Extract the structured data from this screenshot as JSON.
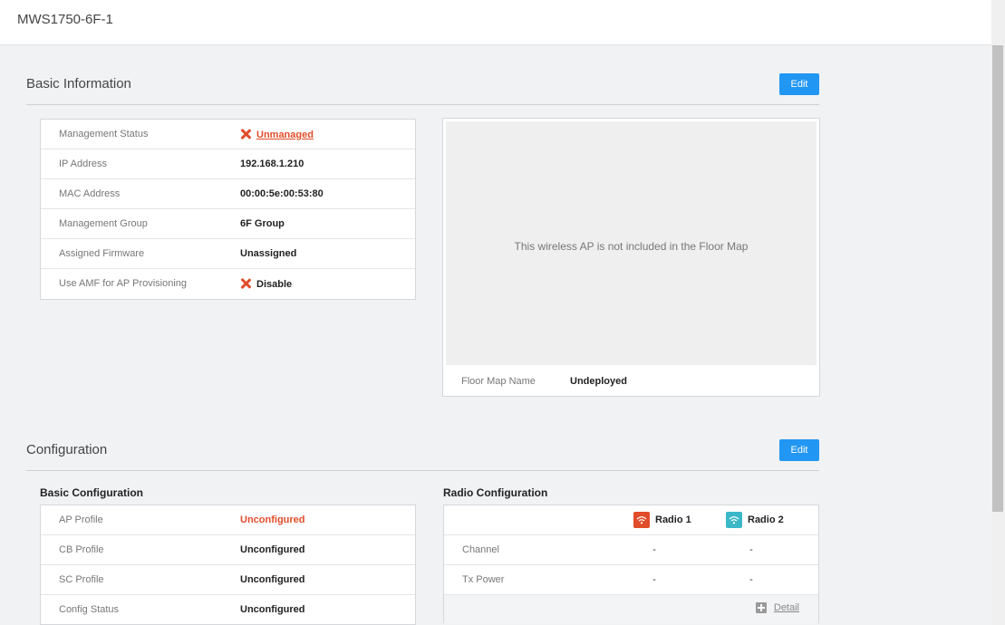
{
  "header": {
    "title": "MWS1750-6F-1"
  },
  "basic_info": {
    "title": "Basic Information",
    "edit_label": "Edit",
    "rows": [
      {
        "label": "Management Status",
        "value": "Unmanaged"
      },
      {
        "label": "IP Address",
        "value": "192.168.1.210"
      },
      {
        "label": "MAC Address",
        "value": "00:00:5e:00:53:80"
      },
      {
        "label": "Management Group",
        "value": "6F Group"
      },
      {
        "label": "Assigned Firmware",
        "value": "Unassigned"
      },
      {
        "label": "Use AMF for AP Provisioning",
        "value": "Disable"
      }
    ],
    "floor_map": {
      "message": "This wireless AP is not included in the Floor Map",
      "name_label": "Floor Map Name",
      "name_value": "Undeployed"
    }
  },
  "configuration": {
    "title": "Configuration",
    "edit_label": "Edit",
    "basic": {
      "title": "Basic Configuration",
      "rows": [
        {
          "label": "AP Profile",
          "value": "Unconfigured"
        },
        {
          "label": "CB Profile",
          "value": "Unconfigured"
        },
        {
          "label": "SC Profile",
          "value": "Unconfigured"
        },
        {
          "label": "Config Status",
          "value": "Unconfigured"
        }
      ]
    },
    "radio": {
      "title": "Radio Configuration",
      "radio1": {
        "label": "Radio 1",
        "color": "#e14d2a"
      },
      "radio2": {
        "label": "Radio 2",
        "color": "#3ab8c8"
      },
      "rows": [
        {
          "label": "Channel",
          "r1": "-",
          "r2": "-"
        },
        {
          "label": "Tx Power",
          "r1": "-",
          "r2": "-"
        }
      ],
      "detail_label": "Detail"
    }
  },
  "colors": {
    "accent": "#2196f3",
    "danger": "#e14d2a",
    "radio2": "#3ab8c8"
  },
  "icons": [
    "close-icon",
    "wifi-icon",
    "plus-icon"
  ]
}
